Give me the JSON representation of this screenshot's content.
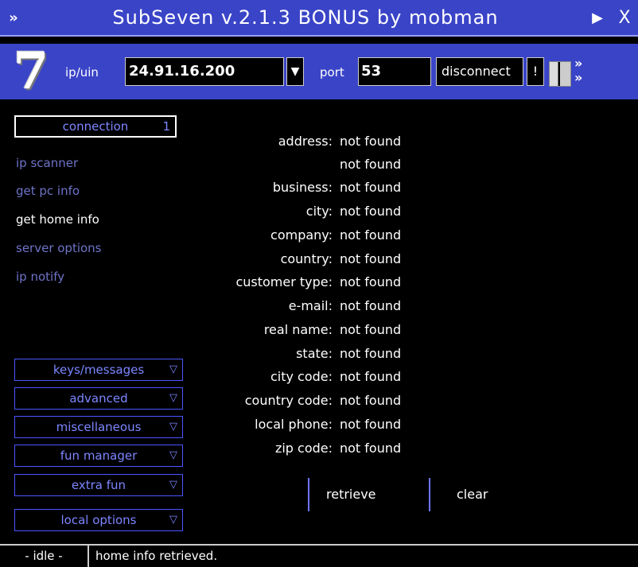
{
  "window": {
    "title": "SubSeven v.2.1.3 BONUS by mobman",
    "left_icon": "»",
    "pin_icon": "▶",
    "close_icon": "X"
  },
  "toolbar": {
    "logo": "7",
    "ip_label": "ip/uin",
    "ip_value": "24.91.16.200",
    "port_label": "port",
    "port_value": "53",
    "disconnect_label": "disconnect",
    "bang_label": "!",
    "more_icon": "»"
  },
  "sidebar": {
    "active": {
      "label": "connection",
      "num": "1"
    },
    "items": [
      {
        "label": "ip scanner"
      },
      {
        "label": "get pc info"
      },
      {
        "label": "get home info"
      },
      {
        "label": "server options"
      },
      {
        "label": "ip notify"
      }
    ],
    "menus": [
      {
        "label": "keys/messages"
      },
      {
        "label": "advanced"
      },
      {
        "label": "miscellaneous"
      },
      {
        "label": "fun manager"
      },
      {
        "label": "extra fun"
      },
      {
        "label": "local options"
      }
    ]
  },
  "info": {
    "rows": [
      {
        "key": "address:",
        "value": "not found"
      },
      {
        "key": "",
        "value": "not found"
      },
      {
        "key": "business:",
        "value": "not found"
      },
      {
        "key": "city:",
        "value": "not found"
      },
      {
        "key": "company:",
        "value": "not found"
      },
      {
        "key": "country:",
        "value": "not found"
      },
      {
        "key": "customer type:",
        "value": "not found"
      },
      {
        "key": "e-mail:",
        "value": "not found"
      },
      {
        "key": "real name:",
        "value": "not found"
      },
      {
        "key": "state:",
        "value": "not found"
      },
      {
        "key": "city code:",
        "value": "not found"
      },
      {
        "key": "country code:",
        "value": "not found"
      },
      {
        "key": "local phone:",
        "value": "not found"
      },
      {
        "key": "zip code:",
        "value": "not found"
      }
    ]
  },
  "actions": {
    "retrieve_label": "retrieve",
    "clear_label": "clear"
  },
  "status": {
    "mode": "- idle -",
    "message": "home info retrieved."
  }
}
